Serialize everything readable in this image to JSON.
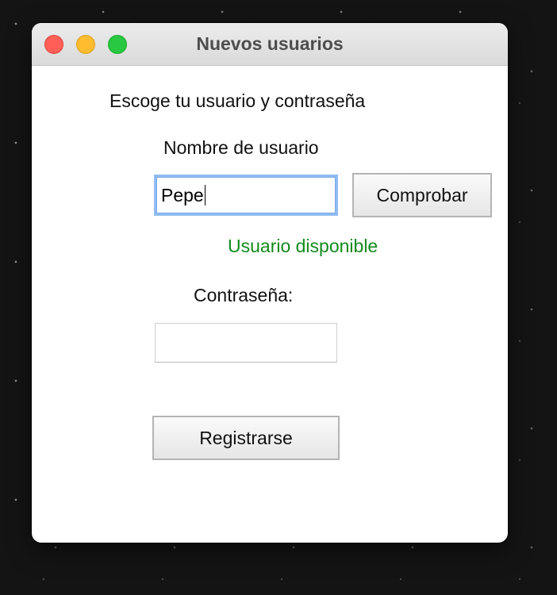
{
  "window": {
    "title": "Nuevos usuarios",
    "colors": {
      "close": "#ff5f57",
      "minimize": "#febc2e",
      "maximize": "#28c840",
      "status_text": "#138a1c",
      "focus_ring": "#8fbcf2"
    }
  },
  "form": {
    "heading": "Escoge tu usuario y contraseña",
    "username_label": "Nombre de usuario",
    "username_value": "Pepe",
    "check_button_label": "Comprobar",
    "status_text": "Usuario disponible",
    "password_label": "Contraseña:",
    "password_value": "",
    "register_button_label": "Registrarse"
  }
}
